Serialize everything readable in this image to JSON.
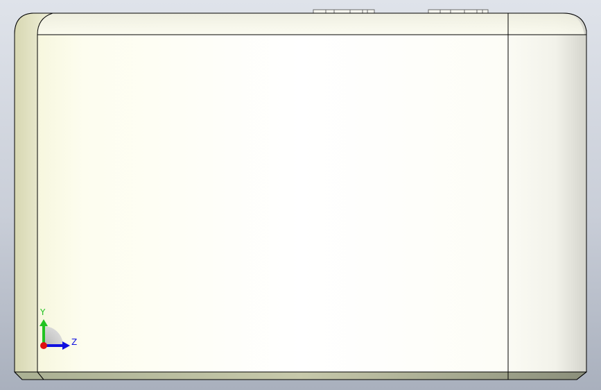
{
  "view": {
    "type": "cad-3d-viewport",
    "part_color": "#fefef2",
    "edge_color": "#000000",
    "background_top": "#dfe3ea",
    "background_bottom": "#a9b0bd"
  },
  "triad": {
    "y_label": "Y",
    "z_label": "Z",
    "y_color": "#22c322",
    "z_color": "#1010e0",
    "x_color": "#e01010"
  }
}
